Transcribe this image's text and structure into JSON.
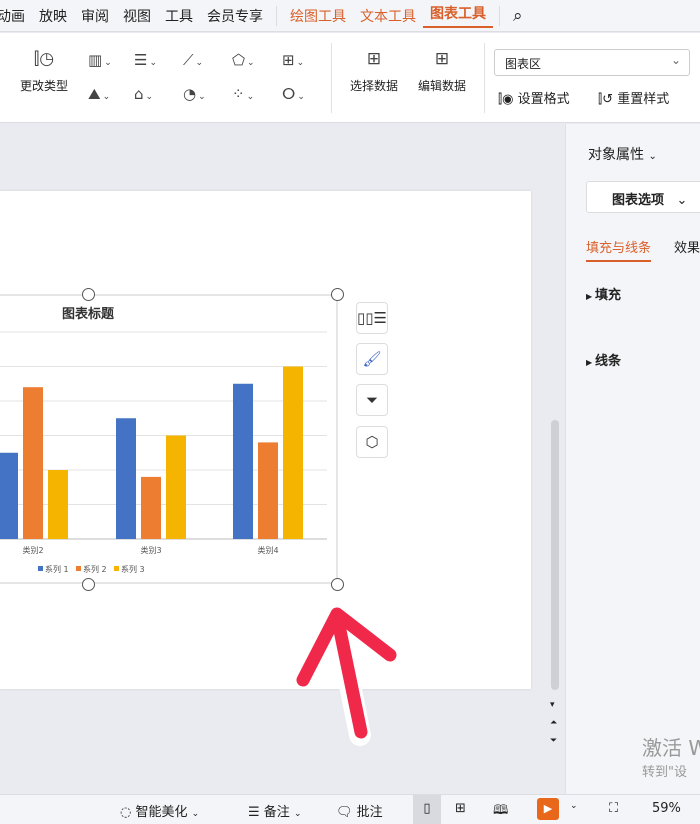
{
  "menu": {
    "items": [
      "动画",
      "放映",
      "审阅",
      "视图",
      "工具",
      "会员专享"
    ],
    "context_tabs": [
      "绘图工具",
      "文本工具",
      "图表工具"
    ],
    "active": "图表工具",
    "search_icon": "search-icon"
  },
  "ribbon": {
    "change_type": "更改类型",
    "select_data": "选择数据",
    "edit_data": "编辑数据",
    "element_select": "图表区",
    "set_format": "设置格式",
    "reset_style": "重置样式"
  },
  "chart": {
    "title": "图表标题"
  },
  "chart_data": {
    "type": "bar",
    "title": "图表标题",
    "categories": [
      "类别2",
      "类别3",
      "类别4"
    ],
    "series": [
      {
        "name": "系列 1",
        "values": [
          2.5,
          3.5,
          4.5
        ],
        "color": "#4472c4"
      },
      {
        "name": "系列 2",
        "values": [
          4.4,
          1.8,
          2.8
        ],
        "color": "#ed7d31"
      },
      {
        "name": "系列 3",
        "values": [
          2,
          3,
          5
        ],
        "color": "#f4b400"
      }
    ],
    "ylim": [
      0,
      6
    ],
    "grid": true,
    "legend": "bottom"
  },
  "panel": {
    "title": "对象属性",
    "dropdown": "图表选项",
    "tabs": [
      "填充与线条",
      "效果"
    ],
    "sections": [
      "填充",
      "线条"
    ]
  },
  "watermark": {
    "line1": "激活 W",
    "line2": "转到\"设"
  },
  "status": {
    "beautify": "智能美化",
    "notes": "备注",
    "comments": "批注",
    "zoom": "59%"
  },
  "accent": "#d9602a"
}
